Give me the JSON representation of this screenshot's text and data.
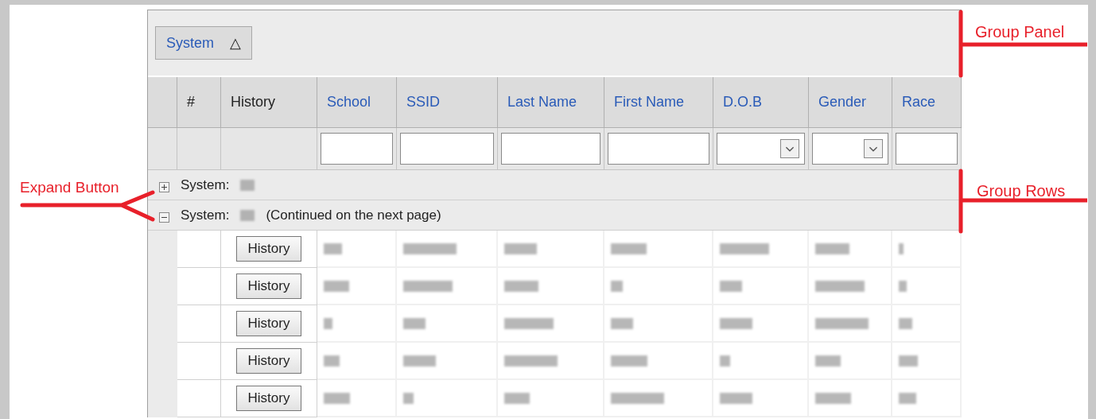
{
  "group_panel": {
    "chips": [
      {
        "label": "System",
        "sort_indicator": "△"
      }
    ]
  },
  "columns": [
    {
      "label": "#",
      "kind": "plain"
    },
    {
      "label": "History",
      "kind": "plain"
    },
    {
      "label": "School",
      "kind": "link",
      "has_filter": true,
      "dropdown": false
    },
    {
      "label": "SSID",
      "kind": "link",
      "has_filter": true,
      "dropdown": false
    },
    {
      "label": "Last Name",
      "kind": "link",
      "has_filter": true,
      "dropdown": false
    },
    {
      "label": "First Name",
      "kind": "link",
      "has_filter": true,
      "dropdown": false
    },
    {
      "label": "D.O.B",
      "kind": "link",
      "has_filter": true,
      "dropdown": true
    },
    {
      "label": "Gender",
      "kind": "link",
      "has_filter": true,
      "dropdown": true
    },
    {
      "label": "Race",
      "kind": "link",
      "has_filter": true,
      "dropdown": false
    }
  ],
  "group_rows": [
    {
      "label": "System:",
      "expanded": false
    },
    {
      "label": "System:",
      "expanded": true,
      "note": "(Continued on the next page)"
    }
  ],
  "rows": [
    {
      "button": "History"
    },
    {
      "button": "History"
    },
    {
      "button": "History"
    },
    {
      "button": "History"
    },
    {
      "button": "History"
    }
  ],
  "annotations": [
    {
      "label": "Group Panel"
    },
    {
      "label": "Group Rows"
    },
    {
      "label": "Expand Button"
    }
  ]
}
